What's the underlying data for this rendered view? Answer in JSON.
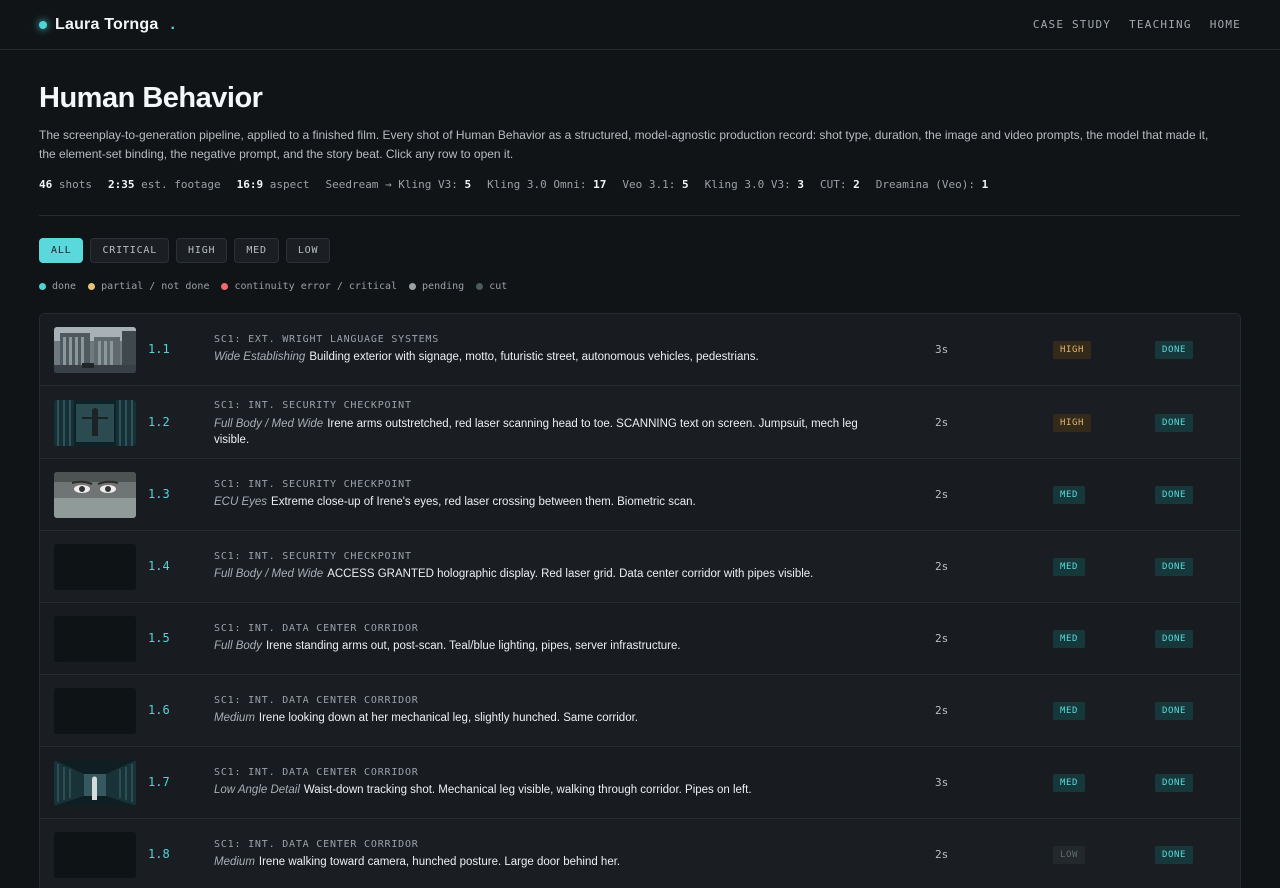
{
  "header": {
    "brand": "Laura Tornga",
    "brand_suffix": ".",
    "nav": [
      "CASE STUDY",
      "TEACHING",
      "HOME"
    ]
  },
  "page": {
    "title": "Human Behavior",
    "description": "The screenplay-to-generation pipeline, applied to a finished film. Every shot of Human Behavior as a structured, model-agnostic production record: shot type, duration, the image and video prompts, the model that made it, the element-set binding, the negative prompt, and the story beat. Click any row to open it."
  },
  "stats": [
    {
      "value": "46",
      "label": " shots"
    },
    {
      "value": "2:35",
      "label": " est. footage"
    },
    {
      "value": "16:9",
      "label": " aspect"
    },
    {
      "label": "Seedream → Kling V3: ",
      "value": "5"
    },
    {
      "label": "Kling 3.0 Omni: ",
      "value": "17"
    },
    {
      "label": "Veo 3.1: ",
      "value": "5"
    },
    {
      "label": "Kling 3.0 V3: ",
      "value": "3"
    },
    {
      "label": "CUT: ",
      "value": "2"
    },
    {
      "label": "Dreamina (Veo): ",
      "value": "1"
    }
  ],
  "filters": [
    "ALL",
    "CRITICAL",
    "HIGH",
    "MED",
    "LOW"
  ],
  "legend": [
    {
      "label": "done",
      "color": "#4fd3d6"
    },
    {
      "label": "partial / not done",
      "color": "#e7c37a"
    },
    {
      "label": "continuity error / critical",
      "color": "#ef6b6b"
    },
    {
      "label": "pending",
      "color": "#9aa0a5"
    },
    {
      "label": "cut",
      "color": "#4d5a5b"
    }
  ],
  "rows": [
    {
      "num": "1.1",
      "scene": "SC1: EXT. WRIGHT LANGUAGE SYSTEMS",
      "type": "Wide Establishing",
      "text": "Building exterior with signage, motto, futuristic street, autonomous vehicles, pedestrians.",
      "dur": "3s",
      "priority": "HIGH",
      "status": "DONE",
      "thumb": "building"
    },
    {
      "num": "1.2",
      "scene": "SC1: INT. SECURITY CHECKPOINT",
      "type": "Full Body / Med Wide",
      "text": "Irene arms outstretched, red laser scanning head to toe. SCANNING text on screen. Jumpsuit, mech leg visible.",
      "dur": "2s",
      "priority": "HIGH",
      "status": "DONE",
      "thumb": "checkpoint"
    },
    {
      "num": "1.3",
      "scene": "SC1: INT. SECURITY CHECKPOINT",
      "type": "ECU Eyes",
      "text": "Extreme close-up of Irene's eyes, red laser crossing between them. Biometric scan.",
      "dur": "2s",
      "priority": "MED",
      "status": "DONE",
      "thumb": "eyes"
    },
    {
      "num": "1.4",
      "scene": "SC1: INT. SECURITY CHECKPOINT",
      "type": "Full Body / Med Wide",
      "text": "ACCESS GRANTED holographic display. Red laser grid. Data center corridor with pipes visible.",
      "dur": "2s",
      "priority": "MED",
      "status": "DONE",
      "thumb": "empty"
    },
    {
      "num": "1.5",
      "scene": "SC1: INT. DATA CENTER CORRIDOR",
      "type": "Full Body",
      "text": "Irene standing arms out, post-scan. Teal/blue lighting, pipes, server infrastructure.",
      "dur": "2s",
      "priority": "MED",
      "status": "DONE",
      "thumb": "empty"
    },
    {
      "num": "1.6",
      "scene": "SC1: INT. DATA CENTER CORRIDOR",
      "type": "Medium",
      "text": "Irene looking down at her mechanical leg, slightly hunched. Same corridor.",
      "dur": "2s",
      "priority": "MED",
      "status": "DONE",
      "thumb": "empty"
    },
    {
      "num": "1.7",
      "scene": "SC1: INT. DATA CENTER CORRIDOR",
      "type": "Low Angle Detail",
      "text": "Waist-down tracking shot. Mechanical leg visible, walking through corridor. Pipes on left.",
      "dur": "3s",
      "priority": "MED",
      "status": "DONE",
      "thumb": "corridor"
    },
    {
      "num": "1.8",
      "scene": "SC1: INT. DATA CENTER CORRIDOR",
      "type": "Medium",
      "text": "Irene walking toward camera, hunched posture. Large door behind her.",
      "dur": "2s",
      "priority": "LOW",
      "status": "DONE",
      "thumb": "empty"
    }
  ]
}
